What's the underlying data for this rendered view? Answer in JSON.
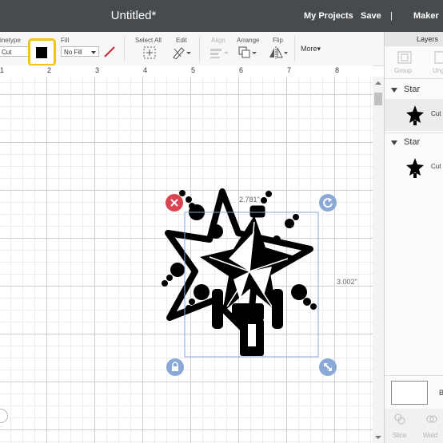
{
  "header": {
    "title": "Untitled*",
    "nav": {
      "projects": "My Projects",
      "save": "Save",
      "separator": "|",
      "maker": "Maker"
    }
  },
  "toolbar": {
    "linetype_label": "inetype",
    "linetype_value": "Cut",
    "fill_label": "Fill",
    "fill_value": "No Fill",
    "select_all": "Select All",
    "edit": "Edit",
    "align": "Align",
    "arrange": "Arrange",
    "flip": "Flip",
    "more": "More",
    "more_caret": "▾",
    "color": "#000000"
  },
  "ruler": {
    "marks": [
      "1",
      "2",
      "3",
      "4",
      "5",
      "6",
      "7",
      "8"
    ]
  },
  "canvas": {
    "width_label": "2.781\"",
    "height_label": "3.002\""
  },
  "panel": {
    "title": "Layers",
    "group": "Group",
    "ungroup": "Ungr",
    "layers": [
      {
        "name": "Star",
        "item": "Cut"
      },
      {
        "name": "Star",
        "item": "Cut"
      }
    ],
    "bottom": {
      "blank": "B",
      "slice": "Slice",
      "weld": "Weld"
    }
  },
  "colors": {
    "topbar": "#484b4e",
    "highlight": "#f2c41a",
    "delete": "#d94452",
    "handle": "#8aa9d6"
  }
}
